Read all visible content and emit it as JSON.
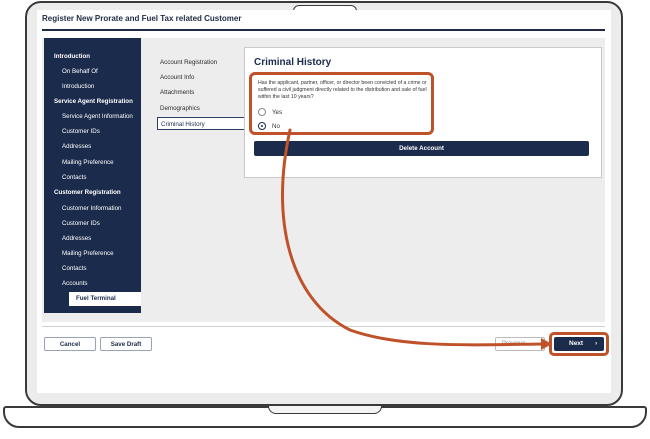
{
  "app": {
    "title": "Register New Prorate and Fuel Tax related Customer"
  },
  "sidebar": {
    "items": [
      {
        "label": "Introduction",
        "kind": "head"
      },
      {
        "label": "On Behalf Of",
        "kind": "sub"
      },
      {
        "label": "Introduction",
        "kind": "sub"
      },
      {
        "label": "Service Agent Registration",
        "kind": "head"
      },
      {
        "label": "Service Agent Information",
        "kind": "sub"
      },
      {
        "label": "Customer IDs",
        "kind": "sub"
      },
      {
        "label": "Addresses",
        "kind": "sub"
      },
      {
        "label": "Mailing Preference",
        "kind": "sub"
      },
      {
        "label": "Contacts",
        "kind": "sub"
      },
      {
        "label": "Customer Registration",
        "kind": "head"
      },
      {
        "label": "Customer Information",
        "kind": "sub"
      },
      {
        "label": "Customer IDs",
        "kind": "sub"
      },
      {
        "label": "Addresses",
        "kind": "sub"
      },
      {
        "label": "Mailing Preference",
        "kind": "sub"
      },
      {
        "label": "Contacts",
        "kind": "sub"
      },
      {
        "label": "Accounts",
        "kind": "sub"
      },
      {
        "label": "Fuel Terminal",
        "kind": "active"
      }
    ]
  },
  "subnav": {
    "items": [
      {
        "label": "Account Registration"
      },
      {
        "label": "Account Info"
      },
      {
        "label": "Attachments"
      },
      {
        "label": "Demographics"
      },
      {
        "label": "Criminal History",
        "active": true
      }
    ]
  },
  "criminal_history": {
    "title": "Criminal History",
    "question": "Has the applicant, partner, officer, or director been convicted of a crime or suffered a civil judgment directly related to the distribution and sale of fuel within the last 10 years?",
    "options": [
      {
        "label": "Yes",
        "checked": false
      },
      {
        "label": "No",
        "checked": true
      }
    ],
    "delete_label": "Delete Account"
  },
  "footer": {
    "cancel_label": "Cancel",
    "save_draft_label": "Save Draft",
    "previous_label": "Previous",
    "next_label": "Next",
    "next_chevron": "›"
  },
  "colors": {
    "navy": "#1b2b4c",
    "highlight": "#c0522a",
    "panel": "#ededed"
  }
}
